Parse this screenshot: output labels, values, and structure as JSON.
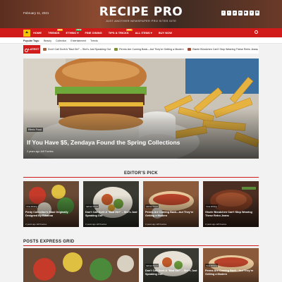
{
  "header": {
    "date": "February 11, 2021",
    "logo": "RECIPE PRO",
    "tagline": "JUST ANOTHER NEWSPAPER PRO SITES SITE",
    "socials": [
      "f",
      "t",
      "p",
      "in",
      "▶",
      "V",
      "✉"
    ]
  },
  "nav": {
    "items": [
      {
        "label": "HOME",
        "badge": ""
      },
      {
        "label": "TRENDS",
        "badge": "HOT",
        "badge_color": "#f5a000"
      },
      {
        "label": "ETHNIC ▾",
        "badge": "NEW",
        "badge_color": "#1e9b3a"
      },
      {
        "label": "FINE DINING",
        "badge": "",
        "badge_color": ""
      },
      {
        "label": "TIPS & TRICKS",
        "badge": "HOT",
        "badge_color": "#f5a000"
      },
      {
        "label": "ALL ITEMS ▾",
        "badge": "",
        "badge_color": ""
      },
      {
        "label": "BUY NOW",
        "badge": "",
        "badge_color": ""
      }
    ]
  },
  "tags": {
    "title": "Popular Tags:",
    "items": [
      "Beauty",
      "Collection",
      "Entertainment",
      "Trends"
    ]
  },
  "latest": {
    "label": "LATEST",
    "items": [
      "Don't Call Dorit A \"Bad Girl\" – She's Just Speaking Out",
      "Perms Are Coming Back—but They're Getting a Modern",
      "Gisele Bündchen Can't Stop Wearing These Retro Jeans"
    ]
  },
  "hero": {
    "category": "Ethnic Food",
    "title": "If You Have $5, Zendaya Found the Spring Collections",
    "meta": "2 years ago   Jeff Fuertes"
  },
  "editors_pick": {
    "title": "EDITOR'S PICK",
    "cards": [
      {
        "category": "Fine Dining",
        "title": "Fenty Collection's Masi Originally Designed By Rihanna",
        "meta": "2 years ago   Jeff Fuertes"
      },
      {
        "category": "Ethnic Food",
        "title": "Don't Call Dorit A \"Bad Girl\" – She's Just Speaking Out",
        "meta": "2 years ago   Jeff Fuertes"
      },
      {
        "category": "Ethnic Food",
        "title": "Perms Are Coming Back—but They're Getting a Modern",
        "meta": "2 years ago   Jeff Fuertes"
      },
      {
        "category": "Fine Dining",
        "title": "Gisele Bündchen Can't Stop Wearing These Retro Jeans",
        "meta": "2 years ago   Jeff Fuertes"
      }
    ]
  },
  "posts_grid": {
    "title": "POSTS EXPRESS GRID",
    "small_cards": [
      {
        "category": "Ethnic Food",
        "title": "Don't Call Dorit A \"Bad Girl\" – She's Just Speaking Out"
      },
      {
        "category": "Fine Dining",
        "title": "Perms Are Coming Back—but They're Getting a Modern"
      }
    ]
  }
}
